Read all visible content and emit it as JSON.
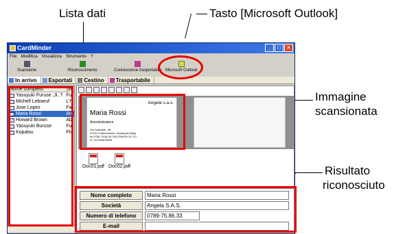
{
  "callouts": {
    "lista_dati": "Lista dati",
    "tasto_outlook": "Tasto [Microsoft Outlook]",
    "immagine_1": "Immagine",
    "immagine_2": "scansionata",
    "risultato_1": "Risultato",
    "risultato_2": "riconosciuto"
  },
  "window": {
    "title": "CardMinder",
    "menu": [
      "File",
      "Modifica",
      "Visualizza",
      "Strumento",
      "?"
    ]
  },
  "toolbar": {
    "scan": "Scansione",
    "recognize": "Riconoscimento",
    "portable": "Connessione trasportabile",
    "outlook": "Microsoft Outlook"
  },
  "tabs": [
    "In arrivo",
    "Esportati",
    "Cestino",
    "Trasportabile"
  ],
  "list": {
    "header": [
      "Nome completo",
      "So"
    ],
    "rows": [
      {
        "name": "Yasuyuki Furuse ,Ji..?",
        "col": "Fu"
      },
      {
        "name": "Michell Leboeuf",
        "col": "L'h"
      },
      {
        "name": "Jose Lopez",
        "col": "Fa"
      },
      {
        "name": "Maria Rossi",
        "col": "An"
      },
      {
        "name": "Howard Brown",
        "col": "Ab"
      },
      {
        "name": "Yasuyuki Buruse",
        "col": "Fu"
      },
      {
        "name": "Kopatsu",
        "col": "Flu"
      }
    ],
    "selected_index": 3
  },
  "card": {
    "company": "Angela s.a.s.",
    "name": "Maria Rossi",
    "role": "Amministratrice",
    "address": [
      "Via Garibaldi , 66",
      "07031 a Marchianna, Sardegna (Italy)",
      "tel.0789-75.86.33    Cell.0336/35.14.712",
      "Fl. 012345678999"
    ]
  },
  "files": [
    "Doc01.pdf",
    "Doc02.pdf"
  ],
  "form": [
    {
      "label": "Nome completo",
      "value": "Maria Rossi"
    },
    {
      "label": "Società",
      "value": "Angela S.A.S."
    },
    {
      "label": "Numero di telefono",
      "value": "0789-75.86.33"
    },
    {
      "label": "E-mail",
      "value": ""
    }
  ],
  "colors": {
    "highlight": "#e50000",
    "selection": "#316ac5",
    "titlebar": "#0a3fb5"
  }
}
